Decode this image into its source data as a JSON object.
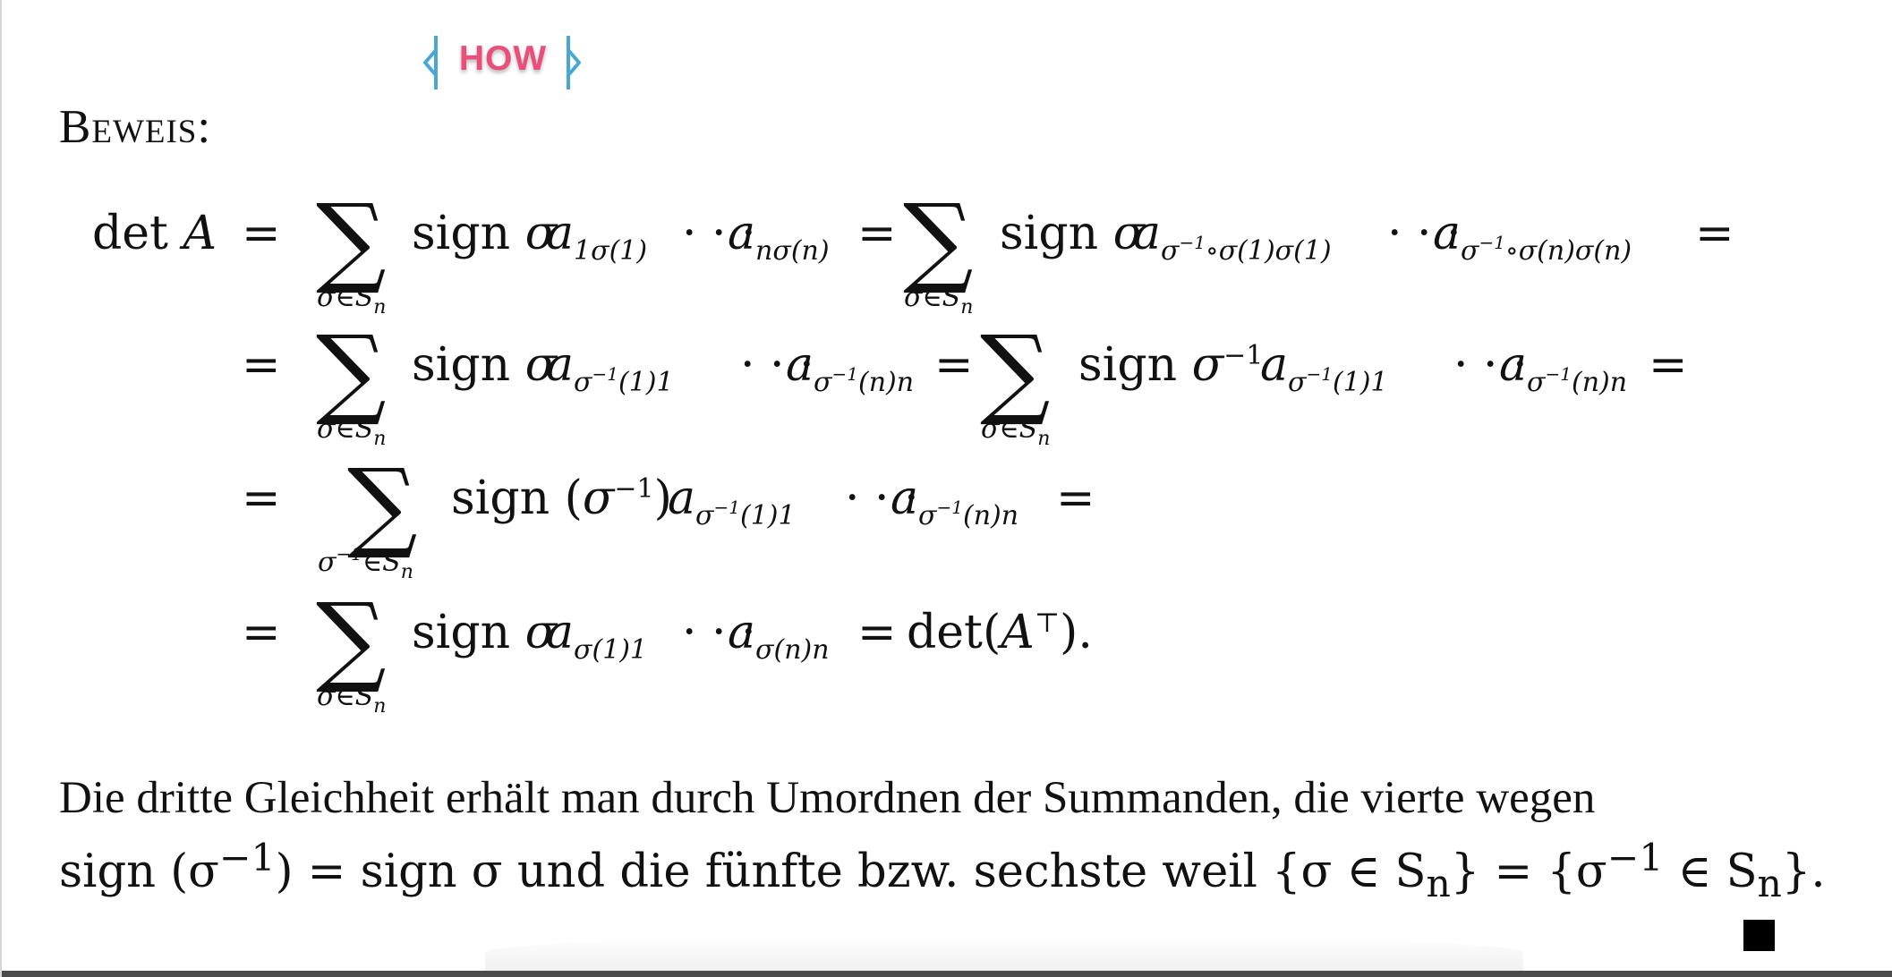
{
  "widget": {
    "label": "HOW",
    "colors": {
      "label": "#ea4f7a",
      "bracket": "#48a7d6"
    }
  },
  "proof": {
    "heading": "Beweis:",
    "equations": [
      {
        "lhs": "det A",
        "sum_index": "σ∈Sn",
        "text": "sign σ a1σ(1) · · · anσ(n) = Σσ∈Sn sign σ aσ−1∘σ(1)σ(1) · · · aσ−1∘σ(n)σ(n) ="
      },
      {
        "sum_index": "σ∈Sn",
        "text": "sign σ aσ−1(1)1 · · · aσ−1(n)n = Σσ∈Sn sign σ−1 aσ−1(1)1 · · · aσ−1(n)n ="
      },
      {
        "sum_index": "σ−1∈Sn",
        "text": "sign (σ−1) aσ−1(1)1 · · · aσ−1(n)n ="
      },
      {
        "sum_index": "σ∈Sn",
        "text": "sign σ aσ(1)1 · · · aσ(n)n = det(A⊤)."
      }
    ],
    "paragraph": {
      "line1": "Die dritte Gleichheit erhält man durch Umordnen der Summanden, die vierte wegen",
      "line2_prefix": "sign (σ",
      "line2_middle": ") = sign σ und die fünfte bzw. sechste weil {σ ∈ S",
      "line2_suffix": "} = {σ",
      "line2_end": " ∈ S",
      "line2_close": "}.",
      "superscript": "−1",
      "subscript": "n"
    },
    "qed_mark": "■"
  }
}
